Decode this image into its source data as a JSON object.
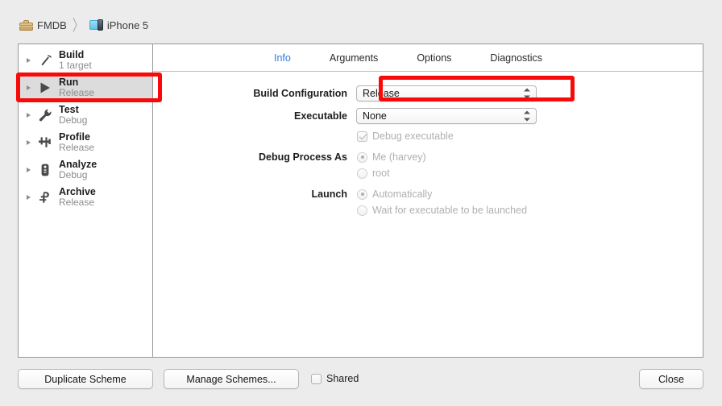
{
  "breadcrumb": {
    "project": "FMDB",
    "destination": "iPhone 5",
    "separator": "〉",
    "project_icon": "toolbox-icon",
    "destination_icon": "iphone-simulator-icon"
  },
  "sidebar": {
    "items": [
      {
        "title": "Build",
        "subtitle": "1 target",
        "icon": "hammer-icon",
        "selected": false
      },
      {
        "title": "Run",
        "subtitle": "Release",
        "icon": "play-icon",
        "selected": true
      },
      {
        "title": "Test",
        "subtitle": "Debug",
        "icon": "wrench-icon",
        "selected": false
      },
      {
        "title": "Profile",
        "subtitle": "Release",
        "icon": "caliper-icon",
        "selected": false
      },
      {
        "title": "Analyze",
        "subtitle": "Debug",
        "icon": "stethoscope-icon",
        "selected": false
      },
      {
        "title": "Archive",
        "subtitle": "Release",
        "icon": "archive-icon",
        "selected": false
      }
    ]
  },
  "tabs": [
    {
      "label": "Info",
      "active": true
    },
    {
      "label": "Arguments",
      "active": false
    },
    {
      "label": "Options",
      "active": false
    },
    {
      "label": "Diagnostics",
      "active": false
    }
  ],
  "form": {
    "build_configuration": {
      "label": "Build Configuration",
      "value": "Release"
    },
    "executable": {
      "label": "Executable",
      "value": "None"
    },
    "debug_executable": {
      "label": "Debug executable",
      "checked": true,
      "enabled": false
    },
    "debug_process_as": {
      "label": "Debug Process As",
      "options": [
        {
          "label": "Me (harvey)",
          "selected": true
        },
        {
          "label": "root",
          "selected": false
        }
      ]
    },
    "launch": {
      "label": "Launch",
      "options": [
        {
          "label": "Automatically",
          "selected": true
        },
        {
          "label": "Wait for executable to be launched",
          "selected": false
        }
      ]
    }
  },
  "footer": {
    "duplicate_scheme": "Duplicate Scheme",
    "manage_schemes": "Manage Schemes...",
    "shared_label": "Shared",
    "shared_checked": false,
    "close": "Close"
  },
  "annotations": {
    "color": "#f90a0a",
    "targets": [
      "run-scheme-row",
      "build-configuration-popup"
    ]
  }
}
